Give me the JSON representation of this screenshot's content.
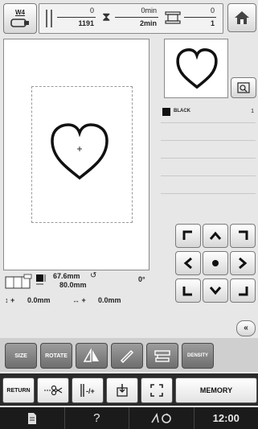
{
  "header": {
    "frame_label": "W4",
    "stitch_current": "0",
    "stitch_total": "1191",
    "time_current": "0min",
    "time_total": "2min",
    "color_current": "0",
    "color_total": "1"
  },
  "thread": {
    "color_name": "BLACK",
    "index": "1"
  },
  "size_info": {
    "width": "67.6mm",
    "height": "80.0mm",
    "rotation": "0°",
    "vertical_offset": "0.0mm",
    "horizontal_offset": "0.0mm"
  },
  "edit_toolbar": {
    "size_label": "SIZE",
    "rotate_label": "ROTATE",
    "density_label": "DENSITY"
  },
  "bottom_toolbar": {
    "return_label": "RETURN",
    "memory_label": "MEMORY"
  },
  "status": {
    "help": "?",
    "clock": "12:00"
  },
  "colors": {
    "dark_button": "#7e7e7e",
    "status_bar": "#1b1b1b"
  }
}
